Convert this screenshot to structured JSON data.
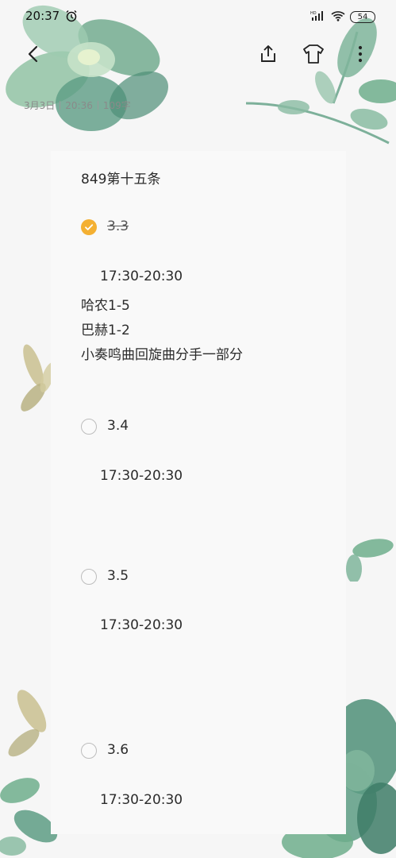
{
  "status_bar": {
    "time": "20:37",
    "network": "HD",
    "battery": "54"
  },
  "toolbar": {
    "icons": [
      "back-arrow-icon",
      "share-icon",
      "theme-shirt-icon",
      "more-vertical-icon"
    ]
  },
  "meta": {
    "date": "3月3日",
    "time": "20:36",
    "chars": "109字"
  },
  "note": {
    "title": "849第十五条",
    "items": [
      {
        "label": "3.3",
        "checked": true,
        "time": "17:30-20:30",
        "extra": [
          "哈农1-5",
          "巴赫1-2",
          "小奏鸣曲回旋曲分手一部分"
        ]
      },
      {
        "label": "3.4",
        "checked": false,
        "time": "17:30-20:30"
      },
      {
        "label": "3.5",
        "checked": false,
        "time": "17:30-20:30"
      },
      {
        "label": "3.6",
        "checked": false,
        "time": "17:30-20:30"
      }
    ]
  },
  "colors": {
    "checkbox_checked": "#f4b032",
    "background": "#f6f6f6",
    "leaf_green": "#6fae8c"
  }
}
